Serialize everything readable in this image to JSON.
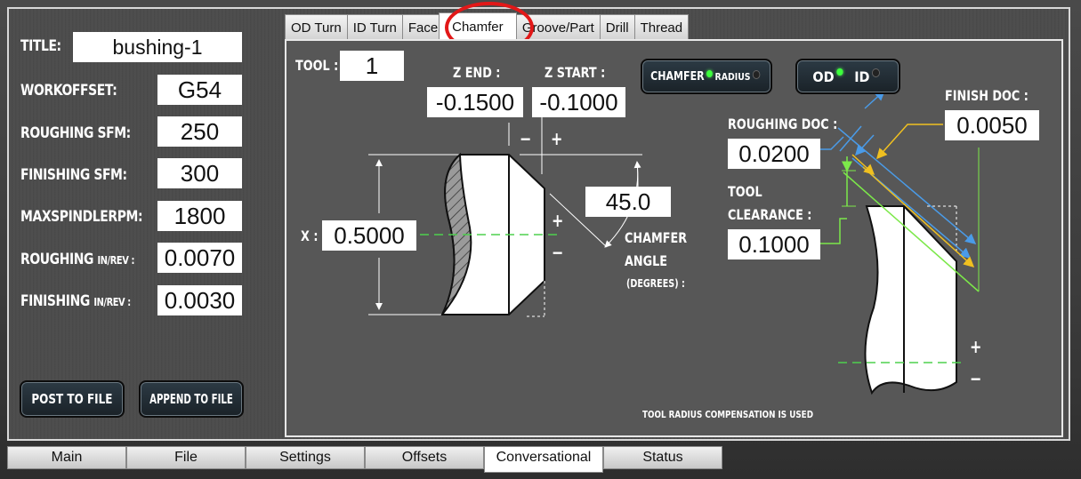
{
  "left_panel": {
    "title_label": "TITLE:",
    "title_value": "bushing-1",
    "work_offset_label": "WORKOFFSET:",
    "work_offset_value": "G54",
    "roughing_sfm_label": "ROUGHING SFM:",
    "roughing_sfm_value": "250",
    "finishing_sfm_label": "FINISHING SFM:",
    "finishing_sfm_value": "300",
    "max_spindle_label": "MAXSPINDLERPM:",
    "max_spindle_value": "1800",
    "roughing_feed_label": "ROUGHING",
    "roughing_feed_unit": "IN/REV :",
    "roughing_feed_value": "0.0070",
    "finishing_feed_label": "FINISHING",
    "finishing_feed_unit": "IN/REV :",
    "finishing_feed_value": "0.0030",
    "post_button": "POST TO FILE",
    "append_button": "APPEND TO FILE"
  },
  "top_tabs": [
    {
      "label": "OD Turn"
    },
    {
      "label": "ID Turn"
    },
    {
      "label": "Face"
    },
    {
      "label": "Chamfer",
      "active": true
    },
    {
      "label": "Groove/Part"
    },
    {
      "label": "Drill"
    },
    {
      "label": "Thread"
    }
  ],
  "chamfer": {
    "tool_label": "TOOL :",
    "tool_value": "1",
    "z_end_label": "Z END :",
    "z_end_value": "-0.1500",
    "z_start_label": "Z START :",
    "z_start_value": "-0.1000",
    "x_label": "X :",
    "x_value": "0.5000",
    "angle_value": "45.0",
    "angle_label_1": "CHAMFER",
    "angle_label_2": "ANGLE",
    "angle_label_3": "(DEGREES) :",
    "minus_sign": "−",
    "plus_sign": "+",
    "chamfer_toggle_left": "CHAMFER",
    "chamfer_toggle_right": "RADIUS",
    "od_toggle_left": "OD",
    "od_toggle_right": "ID",
    "roughing_doc_label": "ROUGHING DOC :",
    "roughing_doc_value": "0.0200",
    "finish_doc_label": "FINISH DOC :",
    "finish_doc_value": "0.0050",
    "tool_clearance_label_1": "TOOL",
    "tool_clearance_label_2": "CLEARANCE :",
    "tool_clearance_value": "0.1000",
    "compensation_note": "TOOL RADIUS COMPENSATION IS USED"
  },
  "bottom_tabs": [
    {
      "label": "Main"
    },
    {
      "label": "File"
    },
    {
      "label": "Settings"
    },
    {
      "label": "Offsets"
    },
    {
      "label": "Conversational",
      "active": true
    },
    {
      "label": "Status"
    }
  ],
  "colors": {
    "highlight": "#e21818",
    "roughing_arrow": "#4a9be8",
    "finish_arrow": "#f0c020",
    "clearance": "#7ce84a",
    "centerline": "#4ed04e",
    "led_on": "#3cff3c"
  }
}
